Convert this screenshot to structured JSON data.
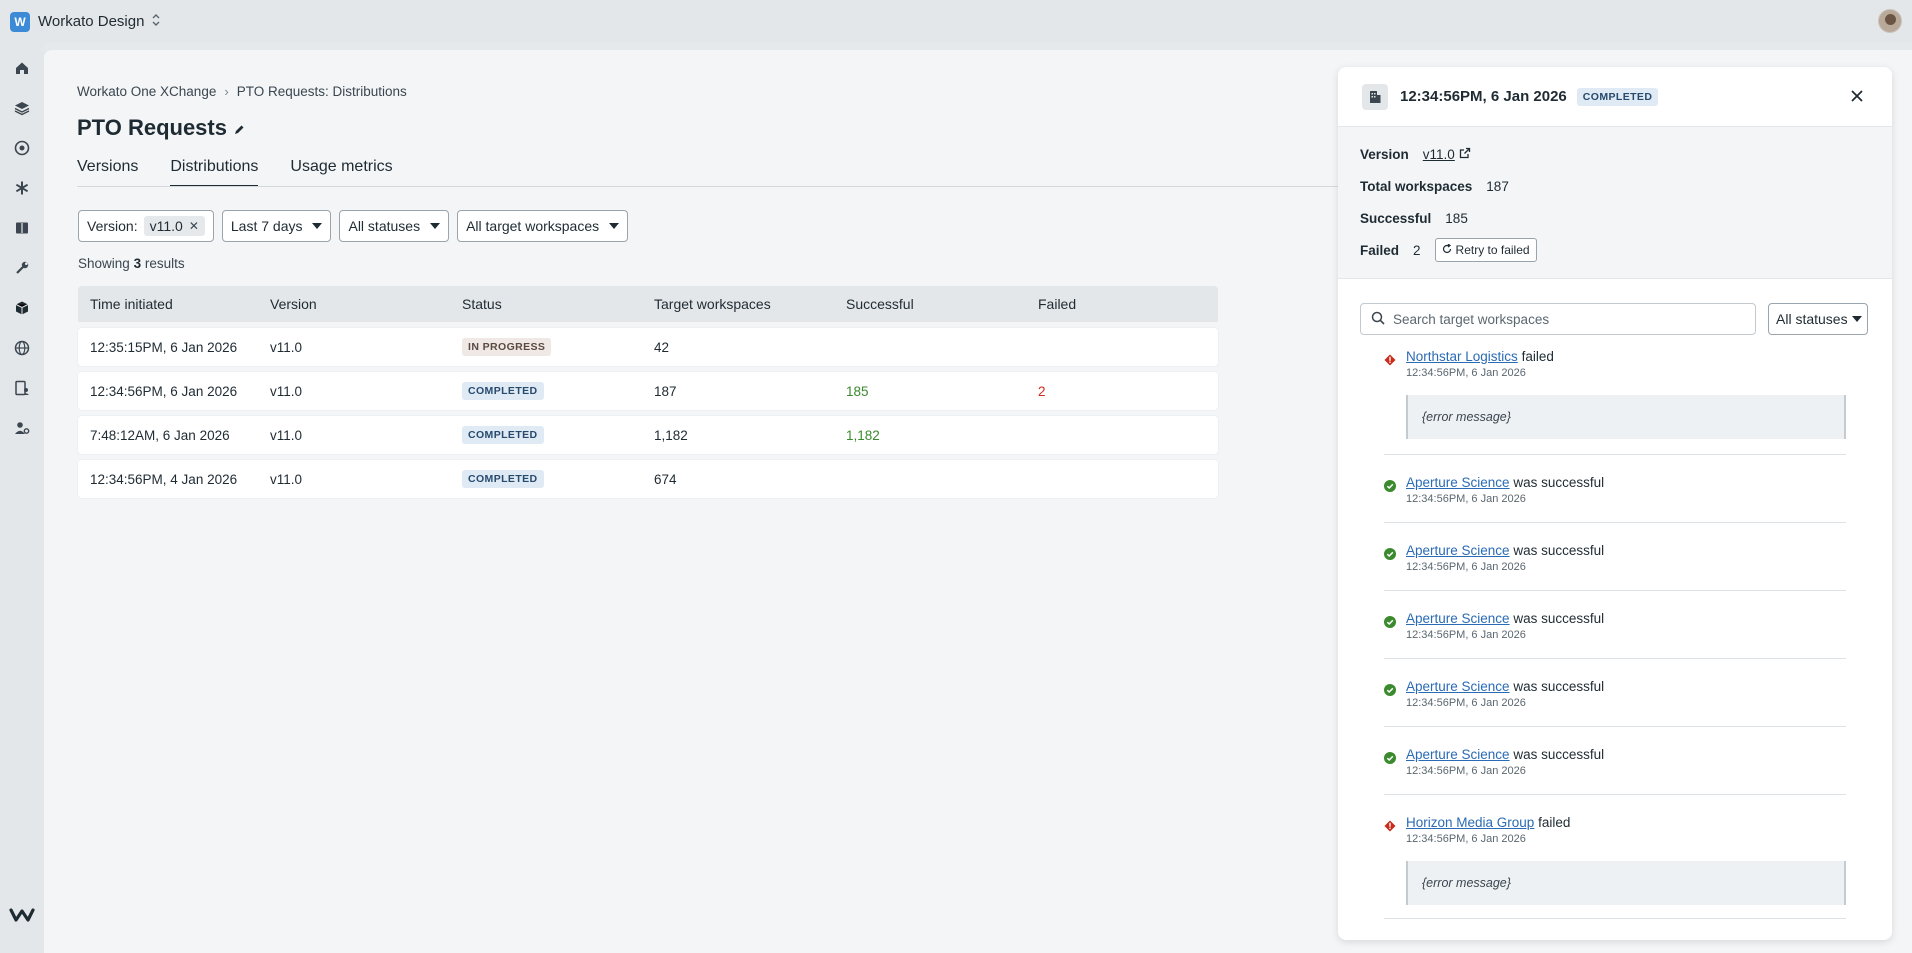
{
  "topbar": {
    "workspace_initial": "W",
    "workspace_name": "Workato Design"
  },
  "breadcrumb": {
    "root": "Workato One XChange",
    "current": "PTO Requests: Distributions"
  },
  "page": {
    "title": "PTO Requests"
  },
  "tabs": [
    {
      "label": "Versions",
      "active": false
    },
    {
      "label": "Distributions",
      "active": true
    },
    {
      "label": "Usage metrics",
      "active": false
    }
  ],
  "filters": {
    "version_label": "Version:",
    "version_value": "v11.0",
    "period": "Last 7 days",
    "statuses": "All statuses",
    "workspaces": "All target workspaces"
  },
  "results": {
    "prefix": "Showing",
    "count": "3",
    "suffix": "results"
  },
  "table": {
    "headers": [
      "Time initiated",
      "Version",
      "Status",
      "Target workspaces",
      "Successful",
      "Failed"
    ],
    "rows": [
      {
        "time": "12:35:15PM, 6 Jan 2026",
        "version": "v11.0",
        "status": "IN PROGRESS",
        "targets": "42",
        "successful": "",
        "failed": ""
      },
      {
        "time": "12:34:56PM, 6 Jan 2026",
        "version": "v11.0",
        "status": "COMPLETED",
        "targets": "187",
        "successful": "185",
        "failed": "2"
      },
      {
        "time": "7:48:12AM, 6 Jan 2026",
        "version": "v11.0",
        "status": "COMPLETED",
        "targets": "1,182",
        "successful": "1,182",
        "failed": ""
      },
      {
        "time": "12:34:56PM, 4 Jan 2026",
        "version": "v11.0",
        "status": "COMPLETED",
        "targets": "674",
        "successful": "",
        "failed": ""
      }
    ]
  },
  "drawer": {
    "title": "12:34:56PM, 6 Jan 2026",
    "status": "COMPLETED",
    "version_label": "Version",
    "version_value": "v11.0",
    "total_label": "Total workspaces",
    "total_value": "187",
    "success_label": "Successful",
    "success_value": "185",
    "failed_label": "Failed",
    "failed_value": "2",
    "retry_label": "Retry to failed",
    "search_placeholder": "Search target workspaces",
    "status_filter": "All statuses",
    "events": [
      {
        "name": "Northstar Logistics",
        "result": "failed",
        "time": "12:34:56PM, 6 Jan 2026",
        "error": "{error message}",
        "ok": false
      },
      {
        "name": "Aperture Science",
        "result": "was successful",
        "time": "12:34:56PM, 6 Jan 2026",
        "error": "",
        "ok": true
      },
      {
        "name": "Aperture Science",
        "result": "was successful",
        "time": "12:34:56PM, 6 Jan 2026",
        "error": "",
        "ok": true
      },
      {
        "name": "Aperture Science",
        "result": "was successful",
        "time": "12:34:56PM, 6 Jan 2026",
        "error": "",
        "ok": true
      },
      {
        "name": "Aperture Science",
        "result": "was successful",
        "time": "12:34:56PM, 6 Jan 2026",
        "error": "",
        "ok": true
      },
      {
        "name": "Aperture Science",
        "result": "was successful",
        "time": "12:34:56PM, 6 Jan 2026",
        "error": "",
        "ok": true
      },
      {
        "name": "Horizon Media Group",
        "result": "failed",
        "time": "12:34:56PM, 6 Jan 2026",
        "error": "{error message}",
        "ok": false
      }
    ]
  },
  "icons": {
    "rail": [
      "home-icon",
      "layers-icon",
      "compass-icon",
      "asterisk-icon",
      "book-icon",
      "wrench-icon",
      "cube-icon",
      "globe-icon",
      "document-user-icon",
      "users-gear-icon"
    ],
    "logo": "workato-logo-icon"
  },
  "colors": {
    "success": "#3c8a2e",
    "error": "#cc2a1b",
    "link": "#2a6bb5",
    "accent": "#3d8bd6"
  }
}
